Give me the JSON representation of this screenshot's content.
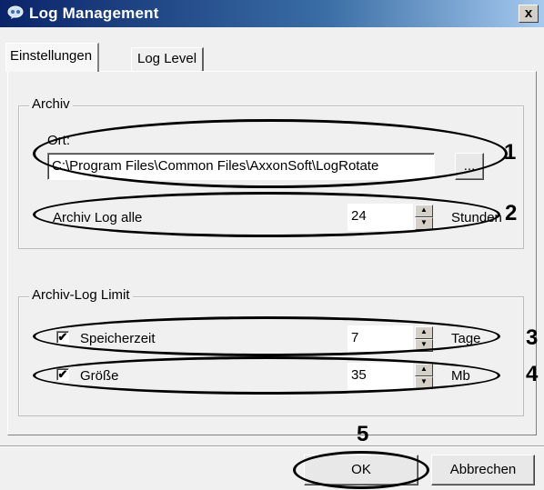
{
  "window": {
    "title": "Log Management",
    "close_label": "x",
    "icon": "app-icon"
  },
  "tabs": [
    {
      "label": "Einstellungen",
      "active": true
    },
    {
      "label": "Log Level",
      "active": false
    }
  ],
  "archive": {
    "group_label": "Archiv",
    "location_label": "Ort:",
    "location_value": "C:\\Program Files\\Common Files\\AxxonSoft\\LogRotate",
    "browse_label": "...",
    "interval_label": "Archiv Log alle",
    "interval_value": "24",
    "interval_unit": "Stunden"
  },
  "limit": {
    "group_label": "Archiv-Log Limit",
    "retention": {
      "checked": true,
      "label": "Speicherzeit",
      "value": "7",
      "unit": "Tage"
    },
    "size": {
      "checked": true,
      "label": "Größe",
      "value": "35",
      "unit": "Mb"
    }
  },
  "buttons": {
    "ok": "OK",
    "cancel": "Abbrechen"
  },
  "annotations": [
    "1",
    "2",
    "3",
    "4",
    "5"
  ],
  "check_mark": "✔"
}
